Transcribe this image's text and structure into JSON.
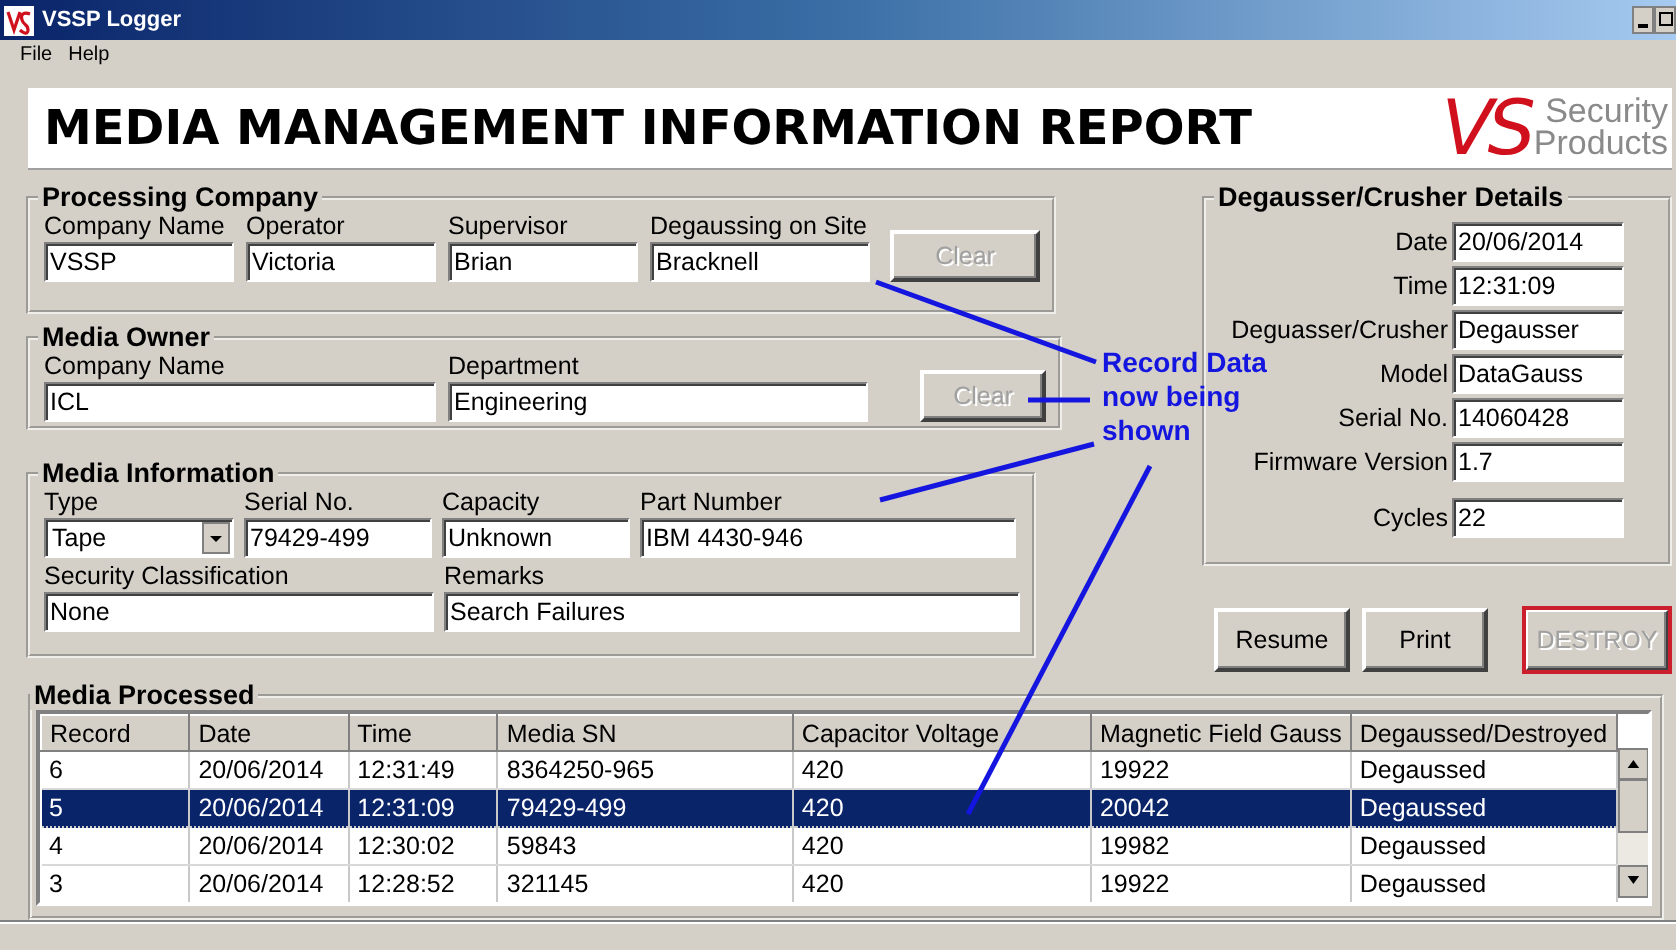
{
  "window": {
    "title": "VSSP Logger"
  },
  "menu": [
    {
      "label": "File"
    },
    {
      "label": "Help"
    }
  ],
  "header": {
    "title": "MEDIA MANAGEMENT INFORMATION REPORT",
    "logo": {
      "mark": "VS",
      "line_1": "Security",
      "line_2": "Products"
    }
  },
  "processing_company": {
    "title": "Processing Company",
    "fields": [
      {
        "label": "Company Name",
        "value": "VSSP"
      },
      {
        "label": "Operator",
        "value": "Victoria"
      },
      {
        "label": "Supervisor",
        "value": "Brian"
      },
      {
        "label": "Degaussing on Site",
        "value": "Bracknell"
      }
    ],
    "clear_button": {
      "label": "Clear",
      "disabled": true
    }
  },
  "media_owner": {
    "title": "Media Owner",
    "fields": [
      {
        "label": "Company Name",
        "value": "ICL"
      },
      {
        "label": "Department",
        "value": "Engineering"
      }
    ],
    "clear_button": {
      "label": "Clear",
      "disabled": true
    }
  },
  "media_information": {
    "title": "Media Information",
    "fields": [
      {
        "label": "Type",
        "value": "Tape",
        "kind": "dropdown"
      },
      {
        "label": "Serial No.",
        "value": "79429-499",
        "kind": "text"
      },
      {
        "label": "Capacity",
        "value": "Unknown",
        "kind": "text"
      },
      {
        "label": "Part Number",
        "value": "IBM 4430-946",
        "kind": "text"
      },
      {
        "label": "Security Classification",
        "value": "None",
        "kind": "text"
      },
      {
        "label": "Remarks",
        "value": "Search Failures",
        "kind": "text"
      }
    ]
  },
  "details": {
    "title": "Degausser/Crusher Details",
    "fields": [
      {
        "label": "Date",
        "value": "20/06/2014"
      },
      {
        "label": "Time",
        "value": "12:31:09"
      },
      {
        "label": "Deguasser/Crusher",
        "value": "Degausser"
      },
      {
        "label": "Model",
        "value": "DataGauss"
      },
      {
        "label": "Serial No.",
        "value": "14060428"
      },
      {
        "label": "Firmware Version",
        "value": "1.7"
      },
      {
        "label": "Cycles",
        "value": "22"
      }
    ]
  },
  "buttons": [
    {
      "label": "Resume",
      "kind": "normal",
      "disabled": false
    },
    {
      "label": "Print",
      "kind": "normal",
      "disabled": false
    },
    {
      "label": "DESTROY",
      "kind": "danger",
      "disabled": true
    }
  ],
  "media_processed": {
    "title": "Media Processed",
    "columns": [
      "Record",
      "Date",
      "Time",
      "Media SN",
      "Capacitor Voltage",
      "Magnetic Field Gauss",
      "Degaussed/Destroyed"
    ],
    "rows": [
      {
        "cells": [
          "6",
          "20/06/2014",
          "12:31:49",
          "8364250-965",
          "420",
          "19922",
          "Degaussed"
        ],
        "selected": false
      },
      {
        "cells": [
          "5",
          "20/06/2014",
          "12:31:09",
          "79429-499",
          "420",
          "20042",
          "Degaussed"
        ],
        "selected": true
      },
      {
        "cells": [
          "4",
          "20/06/2014",
          "12:30:02",
          "59843",
          "420",
          "19982",
          "Degaussed"
        ],
        "selected": false
      },
      {
        "cells": [
          "3",
          "20/06/2014",
          "12:28:52",
          "321145",
          "420",
          "19922",
          "Degaussed"
        ],
        "selected": false
      }
    ]
  },
  "annotation": {
    "text": "Record Data now being shown"
  }
}
